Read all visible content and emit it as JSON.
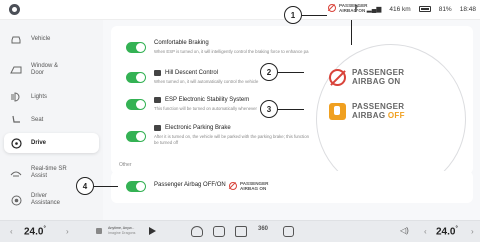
{
  "status": {
    "badge_line1": "PASSENGER",
    "badge_line2": "AIRBAG ON",
    "range": "416 km",
    "battery": "81%",
    "time": "18:48"
  },
  "sidebar": {
    "items": [
      {
        "label": "Vehicle",
        "icon": "car-icon"
      },
      {
        "label": "Window & Door",
        "icon": "window-door-icon"
      },
      {
        "label": "Lights",
        "icon": "light-icon"
      },
      {
        "label": "Seat",
        "icon": "seat-icon"
      },
      {
        "label": "Drive",
        "icon": "steering-icon",
        "active": true
      },
      {
        "label": "Real-time SR Assist",
        "icon": "sr-assist-icon"
      },
      {
        "label": "Driver Assistance",
        "icon": "driver-assist-icon"
      }
    ]
  },
  "settings": {
    "comfortable_braking": {
      "title": "Comfortable Braking",
      "desc": "When ESP is turned on, it will intelligently control the braking force to enhance pa"
    },
    "hill_descent": {
      "title": "Hill Descent Control",
      "desc": "When turned on, it will automatically control the vehicle"
    },
    "esp": {
      "title": "ESP Electronic Stability System",
      "desc": "This function will be turned on automatically whenever"
    },
    "parking_brake": {
      "title": "Electronic Parking Brake",
      "desc_line1": "After it is turned on, the vehicle will be parked with the parking brake; this function",
      "desc_line1b": "automatically in P gear and cannot",
      "desc_line2": "be turned off"
    }
  },
  "callout": {
    "on_line1": "PASSENGER",
    "on_line2": "AIRBAG ON",
    "off_line1": "PASSENGER",
    "off_line2a": "AIRBAG ",
    "off_line2b": "OFF"
  },
  "other": {
    "section_label": "Other",
    "airbag_title": "Passenger Airbag OFF/ON",
    "badge_line1": "PASSENGER",
    "badge_line2": "AIRBAG ON"
  },
  "annotations": [
    "1",
    "2",
    "3",
    "4"
  ],
  "bottom": {
    "left_temp": "24.0",
    "right_temp": "24.0",
    "unit": "°",
    "media_title": "Anytime, Anyw...",
    "media_sub": "Imagine Dragons",
    "ac_label": "360"
  },
  "colors": {
    "toggle_on": "#34b254",
    "airbag_on": "#d9433a",
    "airbag_off": "#f0a020"
  }
}
